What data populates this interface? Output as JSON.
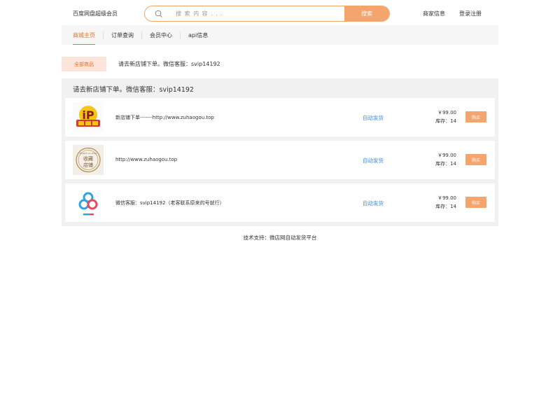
{
  "header": {
    "site_title": "百度网盘超级会员",
    "search_placeholder": "搜 索 内 容 . . .",
    "search_button": "搜索",
    "merchant_link": "商家信息",
    "login_link": "登录注册"
  },
  "nav": {
    "items": [
      {
        "label": "商城主页"
      },
      {
        "label": "订单查询"
      },
      {
        "label": "会员中心"
      },
      {
        "label": "api信息"
      }
    ]
  },
  "category": {
    "all_label": "全部商品",
    "notice": "请去新店铺下单。微信客服：svip14192"
  },
  "panel": {
    "title": "请去新店铺下单。微信客服：svip14192",
    "items": [
      {
        "name": "新店铺下单-------http://www.zuhaogou.top",
        "ship": "自动发货",
        "price": "￥99.00",
        "stock": "库存：14",
        "buy": "购买",
        "thumb_icon": "vip-logo-icon"
      },
      {
        "name": "http://www.zuhaogou.top",
        "ship": "自动发货",
        "price": "￥99.00",
        "stock": "库存：14",
        "buy": "购买",
        "thumb_icon": "bookmark-store-stamp-icon",
        "thumb_text_top": "Collect our shop",
        "thumb_text_main1": "收藏",
        "thumb_text_main2": "店铺"
      },
      {
        "name": "微信客服：svip14192（老客联系原来的号就行）",
        "ship": "自动发货",
        "price": "￥99.00",
        "stock": "库存：14",
        "buy": "购买",
        "thumb_icon": "baidu-netdisk-icon"
      }
    ]
  },
  "footer": {
    "text": "技术支持：微店网自动发货平台"
  },
  "colors": {
    "accent": "#f4a46c",
    "active": "#e8702a",
    "ship": "#3a8ee6",
    "panel_bg": "#f1f1f1"
  }
}
